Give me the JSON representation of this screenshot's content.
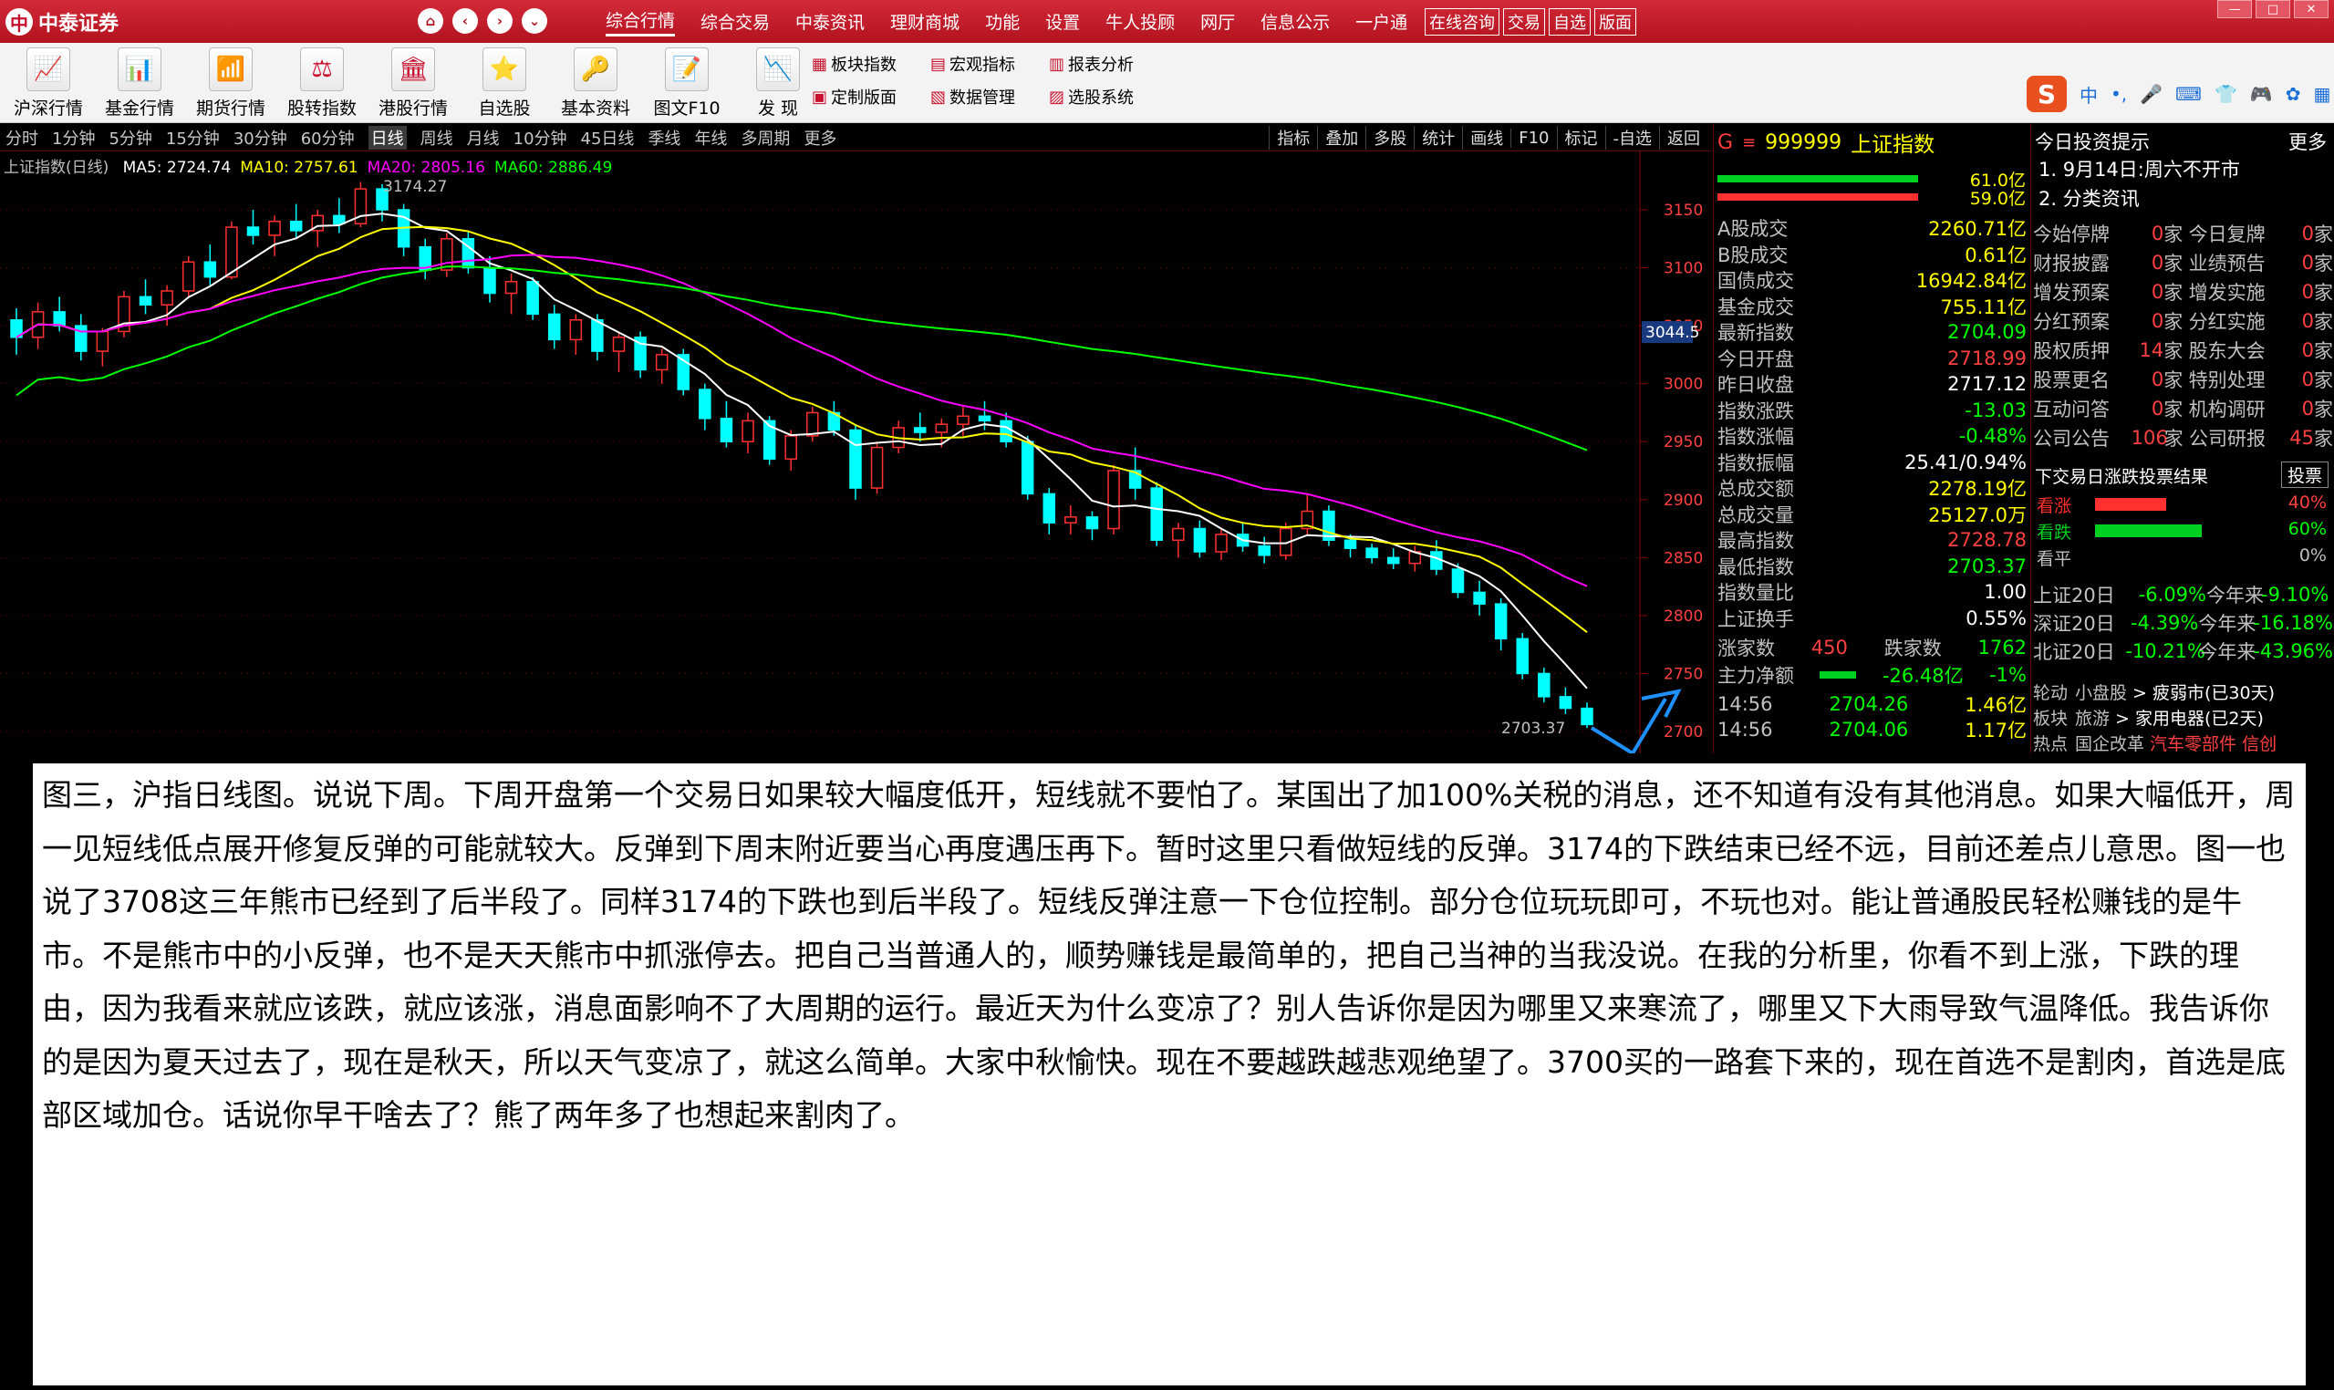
{
  "app": {
    "title": "中泰证券"
  },
  "topmenu": [
    "综合行情",
    "综合交易",
    "中泰资讯",
    "理财商城",
    "功能",
    "设置",
    "牛人投顾",
    "网厅",
    "信息公示",
    "一户通"
  ],
  "topmenu_active": 0,
  "boxmenu": [
    "在线咨询",
    "交易",
    "自选",
    "版面"
  ],
  "toolbar": [
    "沪深行情",
    "基金行情",
    "期货行情",
    "股转指数",
    "港股行情",
    "自选股",
    "基本资料",
    "图文F10",
    "发  现"
  ],
  "toolbar2": [
    "板块指数",
    "宏观指标",
    "报表分析",
    "定制版面",
    "数据管理",
    "选股系统"
  ],
  "periods": [
    "分时",
    "1分钟",
    "5分钟",
    "15分钟",
    "30分钟",
    "60分钟",
    "日线",
    "周线",
    "月线",
    "10分钟",
    "45日线",
    "季线",
    "年线",
    "多周期",
    "更多"
  ],
  "periods_active": 6,
  "chart_tools": [
    "指标",
    "叠加",
    "多股",
    "统计",
    "画线",
    "F10",
    "标记",
    "-自选",
    "返回"
  ],
  "chart": {
    "title": "上证指数(日线)",
    "ma": [
      {
        "label": "MA5: 2724.74",
        "color": "#ffffff"
      },
      {
        "label": "MA10: 2757.61",
        "color": "#ffff00"
      },
      {
        "label": "MA20: 2805.16",
        "color": "#ff00ff"
      },
      {
        "label": "MA60: 2886.49",
        "color": "#00ff00"
      }
    ],
    "high_label": "3174.27",
    "low_label": "2703.37",
    "price_tag": "3044.5",
    "yticks": [
      "3150",
      "3100",
      "3050",
      "3000",
      "2950",
      "2900",
      "2850",
      "2800",
      "2750",
      "2700"
    ]
  },
  "chart_data": {
    "type": "candlestick",
    "title": "上证指数(日线)",
    "y_ticks": [
      3150,
      3100,
      3050,
      3000,
      2950,
      2900,
      2850,
      2800,
      2750,
      2700
    ],
    "ylim": [
      2700,
      3150
    ],
    "annotations": [
      "3174.27",
      "2703.37"
    ],
    "series": [
      {
        "name": "MA5",
        "value": 2724.74,
        "color": "#ffffff"
      },
      {
        "name": "MA10",
        "value": 2757.61,
        "color": "#ffff00"
      },
      {
        "name": "MA20",
        "value": 2805.16,
        "color": "#ff00ff"
      },
      {
        "name": "MA60",
        "value": 2886.49,
        "color": "#00ff00"
      }
    ],
    "ohlc": [
      [
        3055,
        3065,
        3025,
        3040
      ],
      [
        3040,
        3070,
        3030,
        3062
      ],
      [
        3062,
        3075,
        3045,
        3050
      ],
      [
        3050,
        3060,
        3020,
        3028
      ],
      [
        3028,
        3048,
        3015,
        3045
      ],
      [
        3045,
        3080,
        3040,
        3075
      ],
      [
        3075,
        3090,
        3060,
        3068
      ],
      [
        3068,
        3085,
        3050,
        3080
      ],
      [
        3080,
        3110,
        3075,
        3105
      ],
      [
        3105,
        3120,
        3085,
        3092
      ],
      [
        3092,
        3140,
        3090,
        3135
      ],
      [
        3135,
        3150,
        3120,
        3128
      ],
      [
        3128,
        3145,
        3110,
        3140
      ],
      [
        3140,
        3155,
        3125,
        3132
      ],
      [
        3132,
        3150,
        3118,
        3145
      ],
      [
        3145,
        3160,
        3130,
        3138
      ],
      [
        3138,
        3174,
        3135,
        3168
      ],
      [
        3168,
        3172,
        3140,
        3150
      ],
      [
        3150,
        3155,
        3110,
        3118
      ],
      [
        3118,
        3125,
        3090,
        3098
      ],
      [
        3098,
        3130,
        3092,
        3125
      ],
      [
        3125,
        3132,
        3095,
        3100
      ],
      [
        3100,
        3110,
        3070,
        3078
      ],
      [
        3078,
        3095,
        3060,
        3088
      ],
      [
        3088,
        3092,
        3055,
        3060
      ],
      [
        3060,
        3068,
        3030,
        3038
      ],
      [
        3038,
        3060,
        3025,
        3055
      ],
      [
        3055,
        3060,
        3020,
        3028
      ],
      [
        3028,
        3045,
        3010,
        3040
      ],
      [
        3040,
        3045,
        3005,
        3012
      ],
      [
        3012,
        3030,
        3000,
        3025
      ],
      [
        3025,
        3030,
        2990,
        2995
      ],
      [
        2995,
        3000,
        2960,
        2970
      ],
      [
        2970,
        2985,
        2945,
        2950
      ],
      [
        2950,
        2975,
        2940,
        2968
      ],
      [
        2968,
        2972,
        2930,
        2935
      ],
      [
        2935,
        2960,
        2925,
        2955
      ],
      [
        2955,
        2980,
        2950,
        2975
      ],
      [
        2975,
        2985,
        2955,
        2960
      ],
      [
        2960,
        2965,
        2900,
        2910
      ],
      [
        2910,
        2950,
        2905,
        2945
      ],
      [
        2945,
        2968,
        2940,
        2962
      ],
      [
        2962,
        2975,
        2950,
        2958
      ],
      [
        2958,
        2970,
        2945,
        2965
      ],
      [
        2965,
        2980,
        2955,
        2972
      ],
      [
        2972,
        2985,
        2960,
        2968
      ],
      [
        2968,
        2975,
        2945,
        2950
      ],
      [
        2950,
        2955,
        2900,
        2905
      ],
      [
        2905,
        2910,
        2870,
        2880
      ],
      [
        2880,
        2895,
        2870,
        2885
      ],
      [
        2885,
        2890,
        2865,
        2875
      ],
      [
        2875,
        2930,
        2870,
        2925
      ],
      [
        2925,
        2945,
        2900,
        2910
      ],
      [
        2910,
        2915,
        2860,
        2865
      ],
      [
        2865,
        2880,
        2850,
        2875
      ],
      [
        2875,
        2882,
        2850,
        2855
      ],
      [
        2855,
        2875,
        2848,
        2870
      ],
      [
        2870,
        2880,
        2855,
        2860
      ],
      [
        2860,
        2868,
        2845,
        2852
      ],
      [
        2852,
        2880,
        2848,
        2875
      ],
      [
        2875,
        2905,
        2870,
        2890
      ],
      [
        2890,
        2895,
        2860,
        2865
      ],
      [
        2865,
        2870,
        2850,
        2858
      ],
      [
        2858,
        2862,
        2845,
        2850
      ],
      [
        2850,
        2858,
        2840,
        2845
      ],
      [
        2845,
        2860,
        2838,
        2855
      ],
      [
        2855,
        2865,
        2835,
        2840
      ],
      [
        2840,
        2845,
        2815,
        2820
      ],
      [
        2820,
        2830,
        2800,
        2810
      ],
      [
        2810,
        2815,
        2770,
        2780
      ],
      [
        2780,
        2785,
        2745,
        2750
      ],
      [
        2750,
        2755,
        2725,
        2730
      ],
      [
        2730,
        2738,
        2715,
        2720
      ],
      [
        2720,
        2725,
        2703,
        2706
      ]
    ]
  },
  "rpanel": {
    "g": "G",
    "code": "999999",
    "name": "上证指数",
    "bar_vals": [
      "61.0亿",
      "59.0亿"
    ],
    "rows": [
      {
        "k": "A股成交",
        "v": "2260.71亿",
        "c": "#ffff00"
      },
      {
        "k": "B股成交",
        "v": "0.61亿",
        "c": "#ffff00"
      },
      {
        "k": "国债成交",
        "v": "16942.84亿",
        "c": "#ffff00"
      },
      {
        "k": "基金成交",
        "v": "755.11亿",
        "c": "#ffff00"
      },
      {
        "k": "最新指数",
        "v": "2704.09",
        "c": "#00ff00"
      },
      {
        "k": "今日开盘",
        "v": "2718.99",
        "c": "#ff4040"
      },
      {
        "k": "昨日收盘",
        "v": "2717.12",
        "c": "#ffffff"
      },
      {
        "k": "指数涨跌",
        "v": "-13.03",
        "c": "#00ff00"
      },
      {
        "k": "指数涨幅",
        "v": "-0.48%",
        "c": "#00ff00"
      },
      {
        "k": "指数振幅",
        "v": "25.41/0.94%",
        "c": "#ffffff"
      },
      {
        "k": "总成交额",
        "v": "2278.19亿",
        "c": "#ffff00"
      },
      {
        "k": "总成交量",
        "v": "25127.0万",
        "c": "#ffff00"
      },
      {
        "k": "最高指数",
        "v": "2728.78",
        "c": "#ff4040"
      },
      {
        "k": "最低指数",
        "v": "2703.37",
        "c": "#00ff00"
      },
      {
        "k": "指数量比",
        "v": "1.00",
        "c": "#ffffff"
      },
      {
        "k": "上证换手",
        "v": "0.55%",
        "c": "#ffffff"
      }
    ],
    "up_label": "涨家数",
    "up_val": "450",
    "down_label": "跌家数",
    "down_val": "1762",
    "flow_label": "主力净额",
    "flow_val": "-26.48亿",
    "flow_pct": "-1%",
    "ticks": [
      {
        "t": "14:56",
        "p": "2704.26",
        "v": "1.46亿"
      },
      {
        "t": "14:56",
        "p": "2704.06",
        "v": "1.17亿"
      }
    ]
  },
  "fpanel": {
    "header": "今日投资提示",
    "more": "更多",
    "items": [
      "1. 9月14日:周六不开市",
      "2. 分类资讯"
    ],
    "rows": [
      {
        "a": "今始停牌",
        "n": "0",
        "b": "今日复牌",
        "m": "0"
      },
      {
        "a": "财报披露",
        "n": "0",
        "b": "业绩预告",
        "m": "0"
      },
      {
        "a": "增发预案",
        "n": "0",
        "b": "增发实施",
        "m": "0"
      },
      {
        "a": "分红预案",
        "n": "0",
        "b": "分红实施",
        "m": "0"
      },
      {
        "a": "股权质押",
        "n": "14",
        "b": "股东大会",
        "m": "0"
      },
      {
        "a": "股票更名",
        "n": "0",
        "b": "特别处理",
        "m": "0"
      },
      {
        "a": "互动问答",
        "n": "0",
        "b": "机构调研",
        "m": "0"
      },
      {
        "a": "公司公告",
        "n": "106",
        "b": "公司研报",
        "m": "45"
      }
    ],
    "unit": "家",
    "vote_title": "下交易日涨跌投票结果",
    "vote_btn": "投票",
    "votes": [
      {
        "k": "看涨",
        "v": "40%",
        "c": "#ff3030",
        "frac": 0.4
      },
      {
        "k": "看跌",
        "v": "60%",
        "c": "#00d020",
        "frac": 0.6
      },
      {
        "k": "看平",
        "v": "0%",
        "c": "#888888",
        "frac": 0
      }
    ],
    "perf": [
      {
        "a": "上证20日",
        "b": "-6.09%",
        "c": "今年来",
        "d": "-9.10%"
      },
      {
        "a": "深证20日",
        "b": "-4.39%",
        "c": "今年来",
        "d": "-16.18%"
      },
      {
        "a": "北证20日",
        "b": "-10.21%",
        "c": "今年来",
        "d": "-43.96%"
      }
    ],
    "hot": [
      {
        "a": "轮动",
        "b": "小盘股",
        "c": "> 疲弱市(已30天)"
      },
      {
        "a": "板块",
        "b": "旅游",
        "c": "> 家用电器(已2天)"
      },
      {
        "a": "热点",
        "b": "国企改革",
        "c": "汽车零部件  信创"
      }
    ]
  },
  "overlay_text": "图三，沪指日线图。说说下周。下周开盘第一个交易日如果较大幅度低开，短线就不要怕了。某国出了加100%关税的消息，还不知道有没有其他消息。如果大幅低开，周一见短线低点展开修复反弹的可能就较大。反弹到下周末附近要当心再度遇压再下。暂时这里只看做短线的反弹。3174的下跌结束已经不远，目前还差点儿意思。图一也说了3708这三年熊市已经到了后半段了。同样3174的下跌也到后半段了。短线反弹注意一下仓位控制。部分仓位玩玩即可，不玩也对。能让普通股民轻松赚钱的是牛市。不是熊市中的小反弹，也不是天天熊市中抓涨停去。把自己当普通人的，顺势赚钱是最简单的，把自己当神的当我没说。在我的分析里，你看不到上涨，下跌的理由，因为我看来就应该跌，就应该涨，消息面影响不了大周期的运行。最近天为什么变凉了？别人告诉你是因为哪里又来寒流了，哪里又下大雨导致气温降低。我告诉你的是因为夏天过去了，现在是秋天，所以天气变凉了，就这么简单。大家中秋愉快。现在不要越跌越悲观绝望了。3700买的一路套下来的，现在首选不是割肉，首选是底部区域加仓。话说你早干啥去了？熊了两年多了也想起来割肉了。"
}
